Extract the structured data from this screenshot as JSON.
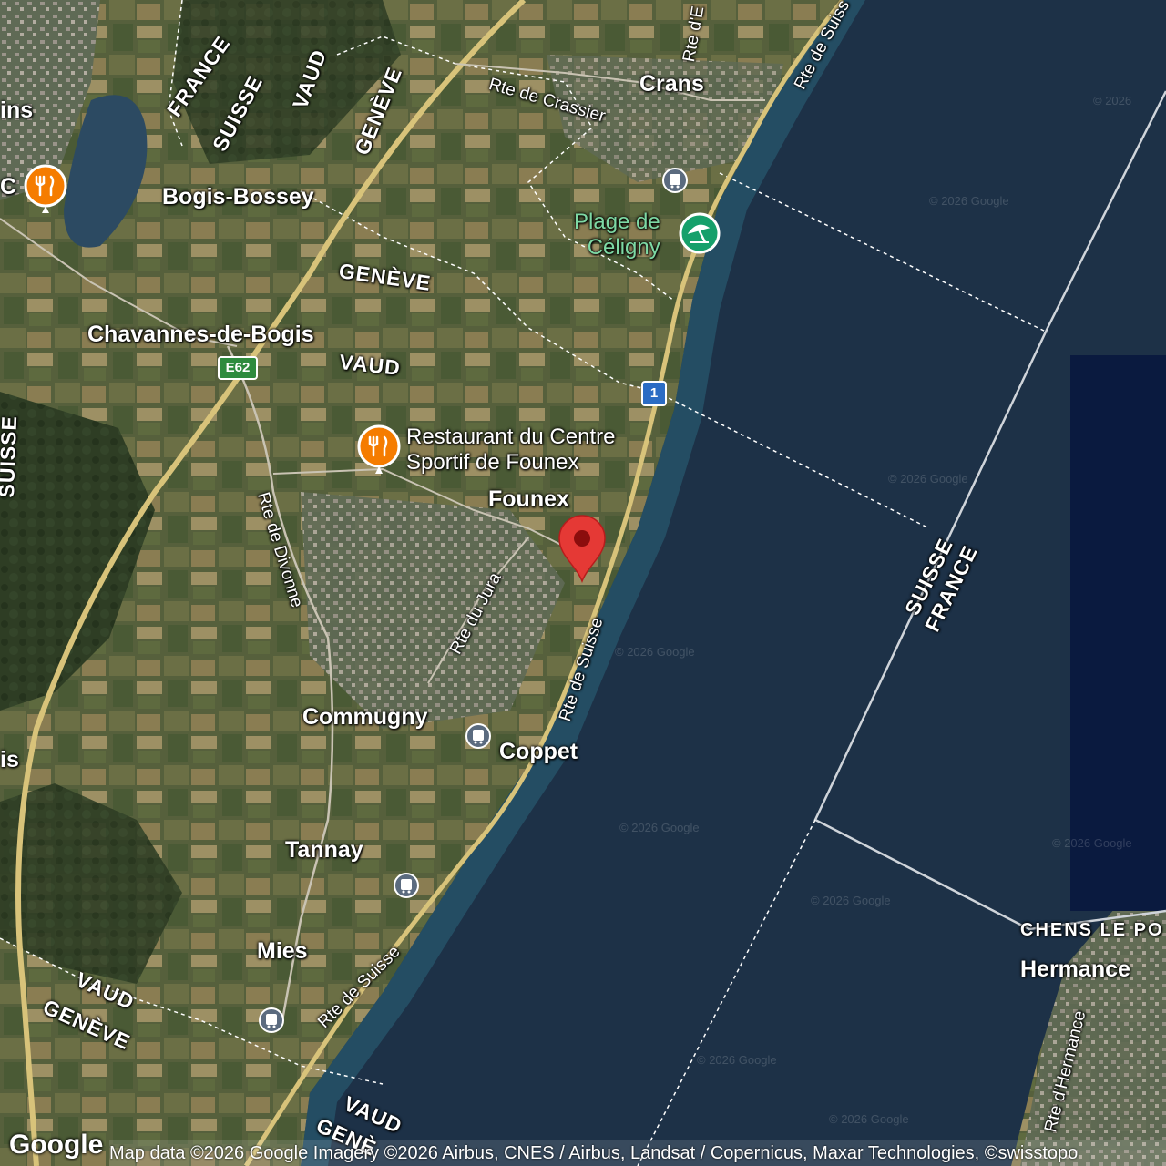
{
  "places": {
    "crans": "Crans",
    "bogis_bossey": "Bogis-Bossey",
    "chavannes": "Chavannes-de-Bogis",
    "founex": "Founex",
    "commugny": "Commugny",
    "coppet": "Coppet",
    "tannay": "Tannay",
    "mies": "Mies",
    "hermance": "Hermance",
    "chens": "CHENS LE PO",
    "divonne_part": "ins",
    "edge_c": "C",
    "edge_is": "is"
  },
  "roads": {
    "crassier": "Rte de Crassier",
    "suisse_top": "Rte de Suiss",
    "e_top": "Rte d'E",
    "divonne": "Rte de Divonne",
    "jura": "Rte du Jura",
    "suisse_mid": "Rte de Suisse",
    "suisse_low": "Rte de Suisse",
    "hermance": "Rte d'Hermance",
    "e62": "E62",
    "route1": "1"
  },
  "regions": {
    "france_top": "FRANCE",
    "suisse_top": "SUISSE",
    "vaud_top": "VAUD",
    "geneve_top": "GENÈVE",
    "geneve_mid": "GENÈVE",
    "vaud_mid": "VAUD",
    "suisse_left": "SUISSE",
    "vaud_low": "VAUD",
    "geneve_low": "GENÈVE",
    "vaud_bottom": "VAUD",
    "geneve_bottom": "GENÈ",
    "suisse_lake": "SUISSE",
    "france_lake": "FRANCE"
  },
  "pois": {
    "restaurant_founex_line1": "Restaurant du Centre",
    "restaurant_founex_line2": "Sportif de Founex",
    "plage_line1": "Plage de",
    "plage_line2": "Céligny"
  },
  "watermark": "© 2026 Google",
  "footer": {
    "logo": "Google",
    "attribution": "Map data ©2026 Google Imagery ©2026 Airbus, CNES / Airbus, Landsat / Copernicus, Maxar Technologies, ©swisstopo"
  },
  "colors": {
    "lake": "#1d3147",
    "land": "#4f5a3a",
    "road_major": "#d8c37a",
    "pin": "#e53935",
    "restaurant_icon": "#f57c00",
    "beach_icon": "#16a06b",
    "transit_icon": "#5b6b7f",
    "deep_water": "#0a1a3f"
  }
}
